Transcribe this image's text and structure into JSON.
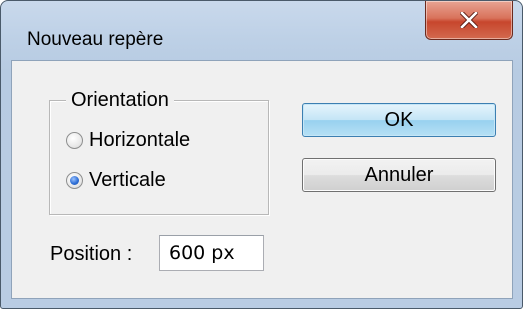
{
  "window": {
    "title": "Nouveau repère",
    "close_icon": "close-x-icon"
  },
  "orientation": {
    "legend": "Orientation",
    "options": [
      {
        "label": "Horizontale",
        "checked": false
      },
      {
        "label": "Verticale",
        "checked": true
      }
    ]
  },
  "position": {
    "label": "Position :",
    "value": "600 px"
  },
  "buttons": {
    "ok_label": "OK",
    "cancel_label": "Annuler"
  },
  "colors": {
    "titlebar": "#c9d9ec",
    "close_button": "#c7462d",
    "ok_button_border": "#3c7fb1",
    "dialog_background": "#f0f0f0"
  }
}
